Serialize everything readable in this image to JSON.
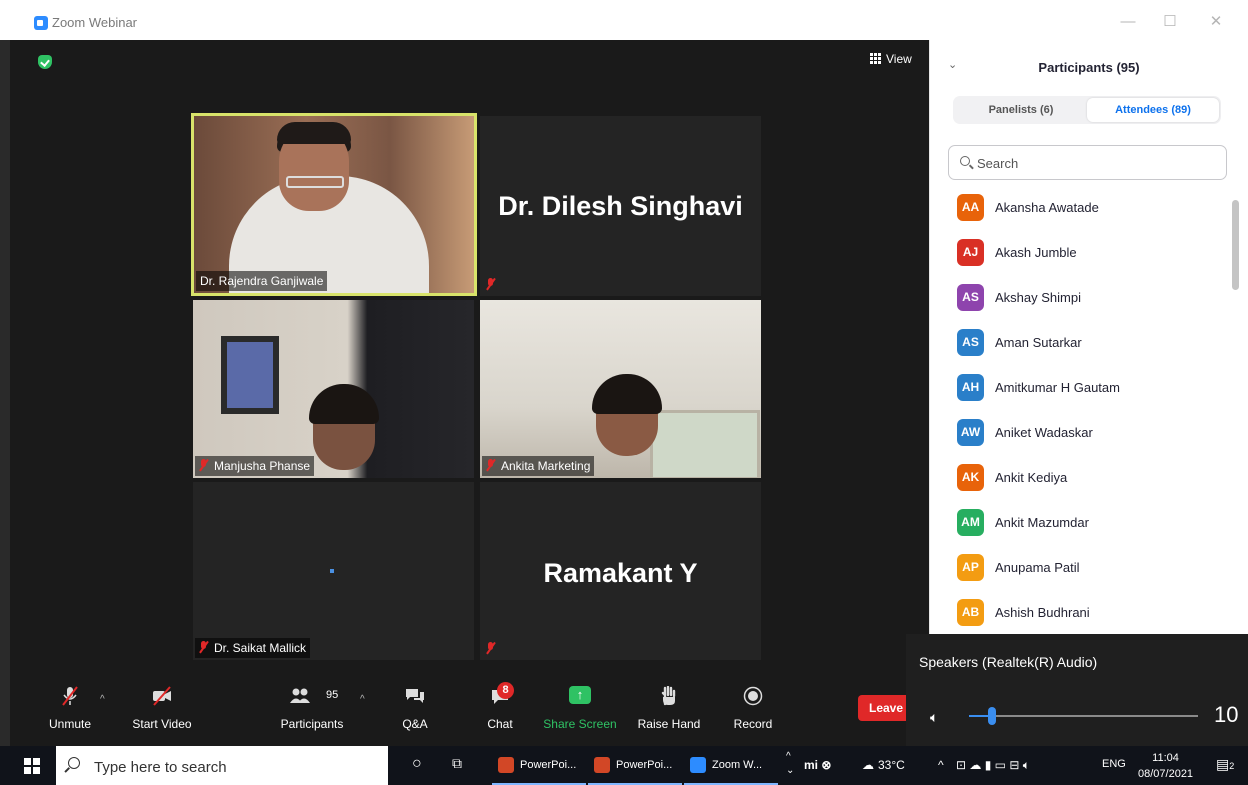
{
  "window": {
    "title": "Zoom Webinar",
    "minimize": "—",
    "maximize": "☐",
    "close": "✕"
  },
  "meeting": {
    "view_label": "View",
    "tiles": [
      {
        "name": "Dr. Rajendra Ganjiwale"
      },
      {
        "name": "Dr. Dilesh Singhavi"
      },
      {
        "name": "Manjusha Phanse"
      },
      {
        "name": "Ankita Marketing"
      },
      {
        "name": "Dr. Saikat Mallick"
      },
      {
        "name": "Ramakant Y"
      }
    ]
  },
  "toolbar": {
    "unmute": "Unmute",
    "start_video": "Start Video",
    "participants": "Participants",
    "participants_count": "95",
    "qa": "Q&A",
    "chat": "Chat",
    "chat_badge": "8",
    "share_screen": "Share Screen",
    "raise_hand": "Raise Hand",
    "record": "Record",
    "leave": "Leave"
  },
  "panel": {
    "title": "Participants (95)",
    "tabs": {
      "panelists": "Panelists (6)",
      "attendees": "Attendees (89)"
    },
    "search_placeholder": "Search",
    "attendees": [
      {
        "initials": "AA",
        "name": "Akansha Awatade",
        "color": "#e8630a"
      },
      {
        "initials": "AJ",
        "name": "Akash Jumble",
        "color": "#d93025"
      },
      {
        "initials": "AS",
        "name": "Akshay Shimpi",
        "color": "#8e44ad"
      },
      {
        "initials": "AS",
        "name": "Aman Sutarkar",
        "color": "#2a7fc9"
      },
      {
        "initials": "AH",
        "name": "Amitkumar H Gautam",
        "color": "#2a7fc9"
      },
      {
        "initials": "AW",
        "name": "Aniket Wadaskar",
        "color": "#2a7fc9"
      },
      {
        "initials": "AK",
        "name": "Ankit Kediya",
        "color": "#e8630a"
      },
      {
        "initials": "AM",
        "name": "Ankit Mazumdar",
        "color": "#27ae60"
      },
      {
        "initials": "AP",
        "name": "Anupama Patil",
        "color": "#f39c12"
      },
      {
        "initials": "AB",
        "name": "Ashish Budhrani",
        "color": "#f39c12"
      }
    ]
  },
  "speakers": {
    "title": "Speakers (Realtek(R) Audio)",
    "volume": 10
  },
  "taskbar": {
    "search_placeholder": "Type here to search",
    "apps": [
      "PowerPoi...",
      "PowerPoi...",
      "Zoom W..."
    ],
    "weather": "33°C",
    "language": "ENG",
    "time": "11:04",
    "date": "08/07/2021",
    "notifications": "2"
  }
}
